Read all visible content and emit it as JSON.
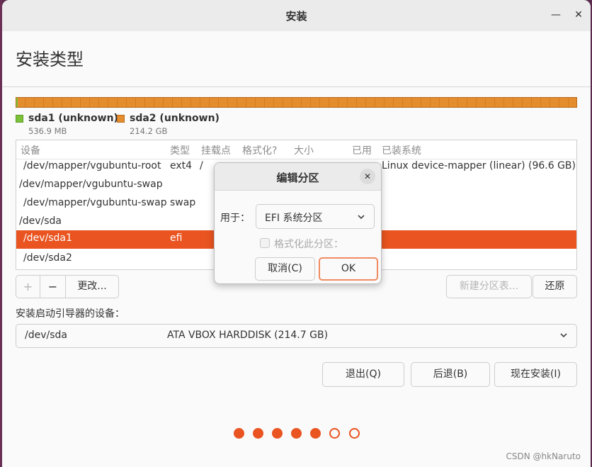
{
  "window": {
    "title": "安装",
    "minimize_label": "—",
    "close_label": "✕"
  },
  "page": {
    "title": "安装类型"
  },
  "partitions_bar": {
    "legend": [
      {
        "name": "sda1 (unknown)",
        "size": "536.9 MB",
        "color": "#7cc239"
      },
      {
        "name": "sda2 (unknown)",
        "size": "214.2 GB",
        "color": "#e48d2e"
      }
    ]
  },
  "table": {
    "headers": [
      "设备",
      "类型",
      "挂载点",
      "格式化?",
      "大小",
      "已用",
      "已装系统"
    ],
    "rows": [
      {
        "device": "/dev/mapper/vgubuntu-root",
        "type": "ext4",
        "mount": "/",
        "system": "Linux device-mapper (linear) (96.6 GB)",
        "selected": false
      },
      {
        "device": "/dev/mapper/vgubuntu-swap",
        "type": "",
        "mount": "",
        "system": "",
        "selected": false
      },
      {
        "device": "/dev/mapper/vgubuntu-swap",
        "type": "swap",
        "mount": "",
        "system": "",
        "selected": false
      },
      {
        "device": "/dev/sda",
        "type": "",
        "mount": "",
        "system": "",
        "selected": false
      },
      {
        "device": "/dev/sda1",
        "type": "efi",
        "mount": "",
        "system": "",
        "selected": true
      },
      {
        "device": "/dev/sda2",
        "type": "",
        "mount": "",
        "system": "",
        "selected": false
      }
    ]
  },
  "toolbar": {
    "add_label": "+",
    "remove_label": "−",
    "change_label": "更改...",
    "new_table_label": "新建分区表...",
    "revert_label": "还原"
  },
  "bootloader": {
    "label": "安装启动引导器的设备：",
    "device": "/dev/sda",
    "description": "ATA VBOX HARDDISK (214.7 GB)"
  },
  "nav": {
    "quit_label": "退出(Q)",
    "back_label": "后退(B)",
    "install_label": "现在安装(I)"
  },
  "progress": {
    "total_steps": 7,
    "completed_steps": 5
  },
  "dialog": {
    "title": "编辑分区",
    "close_label": "✕",
    "use_as_label": "用于：",
    "use_as_value": "EFI 系统分区",
    "format_label": "格式化此分区：",
    "format_checked": false,
    "cancel_label": "取消(C)",
    "ok_label": "OK"
  },
  "watermark": "CSDN @hkNaruto",
  "colors": {
    "accent": "#e95420",
    "partition_orange": "#e48d2e",
    "partition_green": "#7cc239"
  }
}
